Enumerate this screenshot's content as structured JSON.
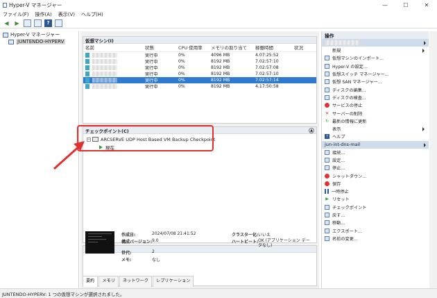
{
  "window": {
    "title": "Hyper-V マネージャー",
    "minimize": "—",
    "maximize": "☐",
    "close": "✕"
  },
  "menu": [
    "ファイル(F)",
    "操作(A)",
    "表示(V)",
    "ヘルプ(H)"
  ],
  "tree": {
    "root": "Hyper-V マネージャー",
    "server": "JUNTENDO-HYPERV"
  },
  "vm_panel": {
    "title": "仮想マシン(I)",
    "columns": [
      "名前",
      "状態",
      "CPU 使用率",
      "メモリの割り当て",
      "稼働時間",
      "状況"
    ],
    "rows": [
      {
        "state": "実行中",
        "cpu": "0%",
        "mem": "4096 MB",
        "uptime": "4.07:25:52",
        "status": "",
        "selected": false
      },
      {
        "state": "実行中",
        "cpu": "0%",
        "mem": "8192 MB",
        "uptime": "7.02:57:10",
        "status": "",
        "selected": false
      },
      {
        "state": "実行中",
        "cpu": "0%",
        "mem": "8192 MB",
        "uptime": "7.02:57:08",
        "status": "",
        "selected": false
      },
      {
        "state": "実行中",
        "cpu": "0%",
        "mem": "8192 MB",
        "uptime": "7.02:57:10",
        "status": "",
        "selected": false
      },
      {
        "state": "実行中",
        "cpu": "0%",
        "mem": "8192 MB",
        "uptime": "7.02:57:14",
        "status": "",
        "selected": true
      },
      {
        "state": "実行中",
        "cpu": "0%",
        "mem": "8192 MB",
        "uptime": "4.17:50:58",
        "status": "",
        "selected": false
      }
    ]
  },
  "checkpoint_panel": {
    "title": "チェックポイント(C)",
    "checkpoint": "ARCSERVE UDP Host Based VM Backup Checkpoint",
    "current": "現在"
  },
  "details": {
    "created_label": "作成日:",
    "created_value": "2024/07/08 21:41:52",
    "config_label": "構成バージョン:",
    "config_value": "9.0",
    "gen_label": "世代:",
    "gen_value": "2",
    "memo_label": "メモ:",
    "memo_value": "なし",
    "cluster_label": "クラスター化:",
    "cluster_value": "いいえ",
    "heartbeat_label": "ハートビート:",
    "heartbeat_value": "OK (アプリケーション データなし)",
    "tabs": [
      "要約",
      "メモリ",
      "ネットワーク",
      "レプリケーション"
    ]
  },
  "actions": {
    "title": "操作",
    "server_items": [
      "新規",
      "仮想マシンのインポート...",
      "Hyper-V の設定...",
      "仮想スイッチ マネージャー...",
      "仮想 SAN マネージャー...",
      "ディスクの編集...",
      "ディスクの検査...",
      "サービスの停止",
      "サーバーの削除",
      "最新の情報に更新",
      "表示",
      "ヘルプ"
    ],
    "vm_name": "jun-int-dns-mail",
    "vm_items": [
      "接続...",
      "設定...",
      "停止...",
      "シャットダウン...",
      "保存",
      "一時停止",
      "リセット",
      "チェックポイント",
      "戻す...",
      "移動...",
      "エクスポート...",
      "名前の変更..."
    ]
  },
  "status": "JUNTENDO-HYPERV: 1 つの仮想マシンが選択されました。"
}
